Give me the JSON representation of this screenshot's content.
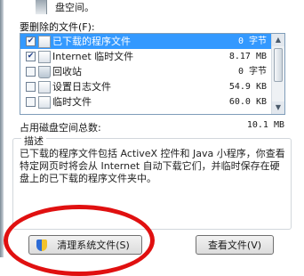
{
  "header": {
    "top_text": "盘空间。",
    "section_label": "要删除的文件(F):"
  },
  "files": [
    {
      "name": "已下载的程序文件",
      "size": "0 字节",
      "checked": true,
      "selected": true
    },
    {
      "name": "Internet 临时文件",
      "size": "8.17 MB",
      "checked": true,
      "selected": false
    },
    {
      "name": "回收站",
      "size": "0 字节",
      "checked": false,
      "selected": false
    },
    {
      "name": "设置日志文件",
      "size": "54.9 KB",
      "checked": false,
      "selected": false
    },
    {
      "name": "临时文件",
      "size": "60.0 KB",
      "checked": false,
      "selected": false
    }
  ],
  "total": {
    "label": "占用磁盘空间总数:",
    "value": "10.1 MB"
  },
  "description": {
    "title": "描述",
    "text": "已下载的程序文件包括 ActiveX 控件和 Java 小程序，你查看特定网页时将会从 Internet 自动下载它们，并临时保存在硬盘上的已下载的程序文件夹中。"
  },
  "buttons": {
    "clean_system": "清理系统文件(S)",
    "view_files": "查看文件(V)"
  },
  "annotation": {
    "highlight_color": "#e01010"
  }
}
